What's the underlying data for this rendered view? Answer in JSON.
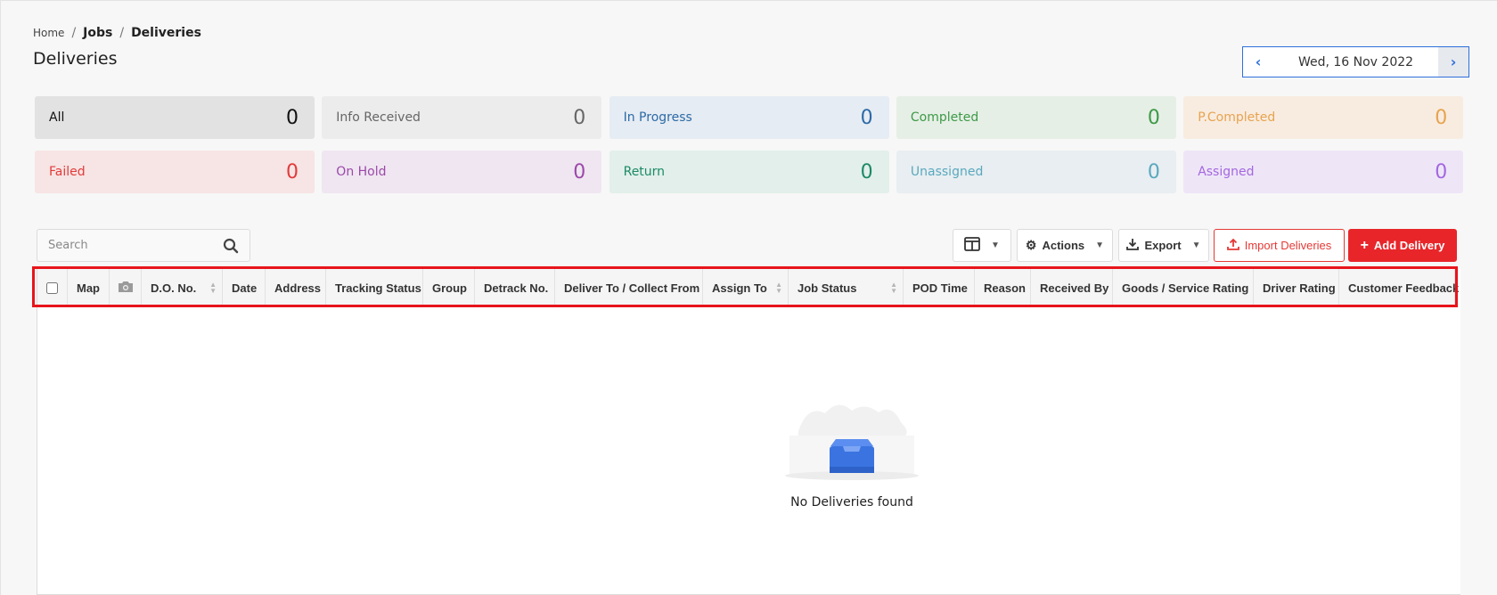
{
  "breadcrumb": {
    "home": "Home",
    "jobs": "Jobs",
    "current": "Deliveries"
  },
  "page": {
    "title": "Deliveries"
  },
  "date_nav": {
    "date": "Wed, 16 Nov 2022"
  },
  "status_cards": [
    {
      "label": "All",
      "count": "0",
      "bg": "#e2e2e2",
      "fg": "#111111",
      "countfg": "#111111"
    },
    {
      "label": "Info Received",
      "count": "0",
      "bg": "#ececec",
      "fg": "#666666",
      "countfg": "#666666"
    },
    {
      "label": "In Progress",
      "count": "0",
      "bg": "#e6ecf3",
      "fg": "#2c6aa6",
      "countfg": "#2c6aa6"
    },
    {
      "label": "Completed",
      "count": "0",
      "bg": "#e6efe6",
      "fg": "#3d9a47",
      "countfg": "#3d9a47"
    },
    {
      "label": "P.Completed",
      "count": "0",
      "bg": "#f8ece0",
      "fg": "#e8a34f",
      "countfg": "#e8a34f"
    },
    {
      "label": "Failed",
      "count": "0",
      "bg": "#f7e4e4",
      "fg": "#e23b3b",
      "countfg": "#e23b3b"
    },
    {
      "label": "On Hold",
      "count": "0",
      "bg": "#efe6f1",
      "fg": "#9b49a8",
      "countfg": "#9b49a8"
    },
    {
      "label": "Return",
      "count": "0",
      "bg": "#e2efea",
      "fg": "#1c8a67",
      "countfg": "#1c8a67"
    },
    {
      "label": "Unassigned",
      "count": "0",
      "bg": "#e8eef1",
      "fg": "#5aa8bf",
      "countfg": "#5aa8bf"
    },
    {
      "label": "Assigned",
      "count": "0",
      "bg": "#eee6f7",
      "fg": "#a467e0",
      "countfg": "#a467e0"
    }
  ],
  "search": {
    "placeholder": "Search"
  },
  "toolbar": {
    "actions_label": "Actions",
    "export_label": "Export",
    "import_label": "Import Deliveries",
    "add_label": "Add Delivery"
  },
  "table": {
    "columns": [
      {
        "label": "",
        "type": "checkbox"
      },
      {
        "label": "Map"
      },
      {
        "label": "",
        "type": "camera"
      },
      {
        "label": "D.O. No.",
        "sort": true
      },
      {
        "label": "Date"
      },
      {
        "label": "Address"
      },
      {
        "label": "Tracking Status"
      },
      {
        "label": "Group"
      },
      {
        "label": "Detrack No."
      },
      {
        "label": "Deliver To / Collect From"
      },
      {
        "label": "Assign To",
        "sort": true
      },
      {
        "label": "Job Status",
        "sort": true
      },
      {
        "label": "POD Time"
      },
      {
        "label": "Reason"
      },
      {
        "label": "Received By"
      },
      {
        "label": "Goods / Service Rating"
      },
      {
        "label": "Driver Rating"
      },
      {
        "label": "Customer Feedback"
      }
    ],
    "empty_text": "No Deliveries found"
  },
  "colors": {
    "accent": "#2f6fdb",
    "danger": "#e8262a",
    "highlight": "#e8141b"
  }
}
